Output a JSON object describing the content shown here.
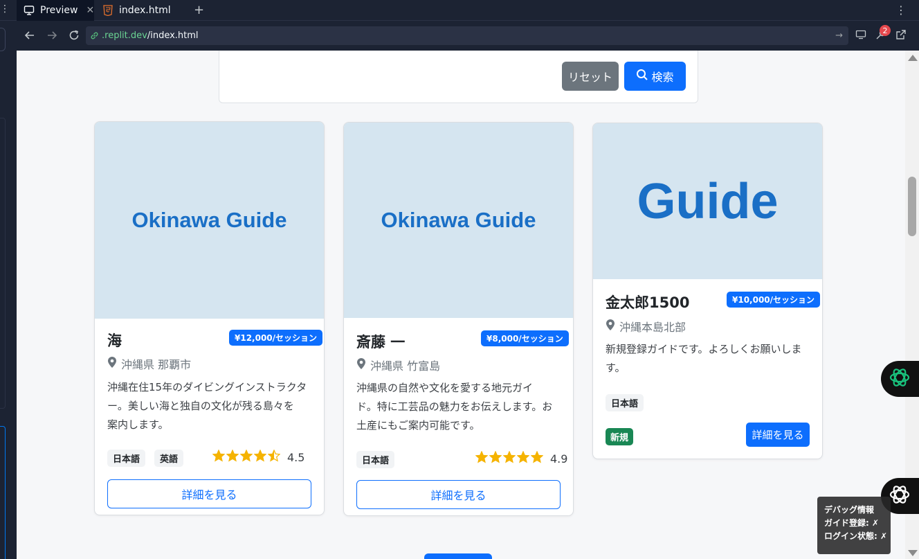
{
  "tabs": [
    {
      "label": "Preview",
      "icon": "monitor-icon",
      "active": true
    },
    {
      "label": "index.html",
      "icon": "html5-icon",
      "active": false
    }
  ],
  "url": {
    "domain": ".replit.dev",
    "path": "/index.html"
  },
  "notification_count": "2",
  "search_panel": {
    "reset_label": "リセット",
    "search_label": "検索"
  },
  "cards": [
    {
      "image_text": "Okinawa Guide",
      "name": "海",
      "price": "¥12,000/セッション",
      "location": "沖縄県 那覇市",
      "description": [
        "沖縄在住15年のダイビングインストラクタ",
        "ー。美しい海と独自の文化が残る島々を",
        "案内します。"
      ],
      "languages": [
        "日本語",
        "英語"
      ],
      "rating": 4.5,
      "rating_label": "4.5",
      "button": "詳細を見る"
    },
    {
      "image_text": "Okinawa Guide",
      "name": "斎藤 一",
      "price": "¥8,000/セッション",
      "location": "沖縄県 竹富島",
      "description": [
        "沖縄県の自然や文化を愛する地元ガイ",
        "ド。特に工芸品の魅力をお伝えします。お",
        "土産にもご案内可能です。"
      ],
      "languages": [
        "日本語"
      ],
      "rating": 4.9,
      "rating_label": "4.9",
      "button": "詳細を見る"
    },
    {
      "image_text": "Guide",
      "name": "金太郎1500",
      "price": "¥10,000/セッション",
      "location": "沖縄本島北部",
      "description": [
        "新規登録ガイドです。よろしくお願いしま",
        "す。"
      ],
      "languages": [
        "日本語"
      ],
      "new_badge": "新規",
      "button": "詳細を見る"
    }
  ],
  "debug": {
    "title": "デバッグ情報",
    "line1": "ガイド登録: ✗",
    "line2": "ログイン状態: ✗"
  },
  "colors": {
    "primary": "#0d6efd",
    "secondary": "#6c757d",
    "success": "#198754",
    "star": "#f5b301"
  }
}
